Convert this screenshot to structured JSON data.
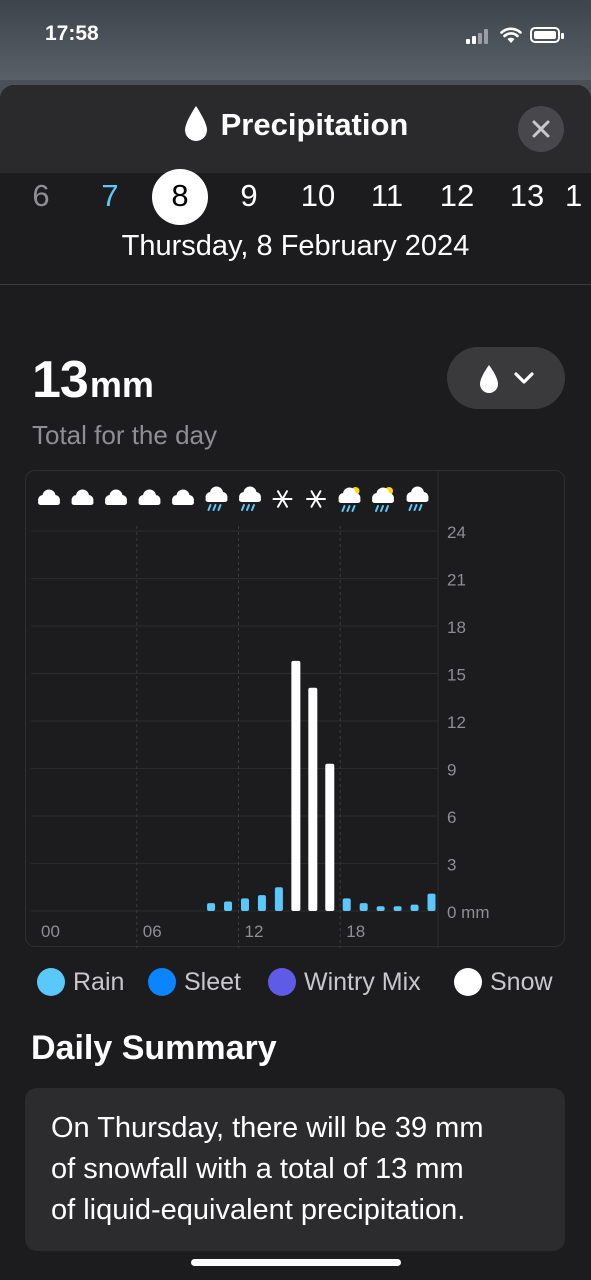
{
  "status": {
    "time": "17:58"
  },
  "header": {
    "title": "Precipitation",
    "icon": "drop-icon",
    "close_icon": "close-icon"
  },
  "days": [
    {
      "label": "6",
      "state": "past"
    },
    {
      "label": "7",
      "state": "today"
    },
    {
      "label": "8",
      "state": "selected"
    },
    {
      "label": "9",
      "state": "future"
    },
    {
      "label": "10",
      "state": "future"
    },
    {
      "label": "11",
      "state": "future"
    },
    {
      "label": "12",
      "state": "future"
    },
    {
      "label": "13",
      "state": "future"
    },
    {
      "label": "1",
      "state": "future"
    }
  ],
  "date_label": "Thursday, 8 February 2024",
  "total": {
    "value": "13",
    "unit": "mm",
    "label": "Total for the day"
  },
  "metric_button": {
    "icon": "drop-icon",
    "chevron": "chevron-down-icon"
  },
  "chart_data": {
    "type": "bar",
    "x_tick_labels": [
      "00",
      "06",
      "12",
      "18"
    ],
    "y_tick_labels": [
      "24",
      "21",
      "18",
      "15",
      "12",
      "9",
      "6",
      "3",
      "0 mm"
    ],
    "ylim": [
      0,
      24
    ],
    "weather_icons": [
      "cloud",
      "cloud",
      "cloud",
      "cloud",
      "cloud",
      "cloud-rain",
      "cloud-rain",
      "snowflake",
      "snowflake",
      "sun-cloud-rain",
      "sun-cloud-rain",
      "cloud-rain"
    ],
    "series": [
      {
        "name": "Rain",
        "color": "#5ac8fa",
        "hours": [
          10,
          11,
          12,
          13,
          14,
          18,
          19,
          20,
          21,
          22,
          23
        ],
        "values": [
          0.5,
          0.6,
          0.8,
          1.0,
          1.5,
          0.8,
          0.5,
          0.3,
          0.3,
          0.4,
          1.1
        ]
      },
      {
        "name": "Snow",
        "color": "#ffffff",
        "hours": [
          15,
          16,
          17
        ],
        "values": [
          15.8,
          14.1,
          9.3
        ]
      }
    ]
  },
  "legend": [
    {
      "label": "Rain",
      "color": "#5ac8fa"
    },
    {
      "label": "Sleet",
      "color": "#0a84ff"
    },
    {
      "label": "Wintry Mix",
      "color": "#5e5ce6"
    },
    {
      "label": "Snow",
      "color": "#ffffff"
    }
  ],
  "summary": {
    "title": "Daily Summary",
    "lines": [
      "On Thursday, there will be 39 mm",
      "of snowfall with a total of 13 mm",
      "of liquid-equivalent precipitation."
    ]
  }
}
